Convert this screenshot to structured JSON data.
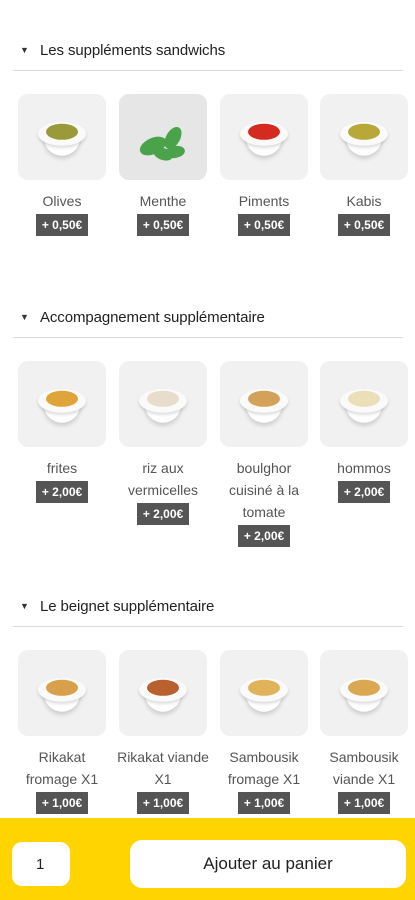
{
  "sections": [
    {
      "title": "Les suppléments sandwichs",
      "items": [
        {
          "name": "Olives",
          "price": "+ 0,50€",
          "icon": "olives-bowl-icon",
          "food_color": "#9a9a3a"
        },
        {
          "name": "Menthe",
          "price": "+ 0,50€",
          "icon": "mint-leaves-icon",
          "food_color": "#4aa34a"
        },
        {
          "name": "Piments",
          "price": "+ 0,50€",
          "icon": "peppers-bowl-icon",
          "food_color": "#d42a1f"
        },
        {
          "name": "Kabis",
          "price": "+ 0,50€",
          "icon": "pickles-bowl-icon",
          "food_color": "#b8a83a"
        }
      ]
    },
    {
      "title": "Accompagnement supplémentaire",
      "items": [
        {
          "name": "frites",
          "price": "+ 2,00€",
          "icon": "fries-bowl-icon",
          "food_color": "#e0a53a"
        },
        {
          "name": "riz aux vermicelles",
          "price": "+ 2,00€",
          "icon": "rice-bowl-icon",
          "food_color": "#e8dccb"
        },
        {
          "name": "boulghor cuisiné à la tomate",
          "price": "+ 2,00€",
          "icon": "bulgur-bowl-icon",
          "food_color": "#d4a15a"
        },
        {
          "name": "hommos",
          "price": "+ 2,00€",
          "icon": "hummus-bowl-icon",
          "food_color": "#eadfb8"
        }
      ]
    },
    {
      "title": "Le beignet supplémentaire",
      "items": [
        {
          "name": "Rikakat fromage X1",
          "price": "+ 1,00€",
          "icon": "rolls-bowl-icon",
          "food_color": "#d8a04a"
        },
        {
          "name": "Rikakat viande X1",
          "price": "+ 1,00€",
          "icon": "rolls-bowl-icon",
          "food_color": "#b8602e"
        },
        {
          "name": "Sambousik fromage X1",
          "price": "+ 1,00€",
          "icon": "pastry-bowl-icon",
          "food_color": "#e0b25a"
        },
        {
          "name": "Sambousik viande X1",
          "price": "+ 1,00€",
          "icon": "pastry-bowl-icon",
          "food_color": "#d9a850"
        }
      ]
    }
  ],
  "cart": {
    "quantity": "1",
    "add_label": "Ajouter au panier"
  },
  "colors": {
    "accent": "#ffd400",
    "price_badge": "#555555"
  }
}
